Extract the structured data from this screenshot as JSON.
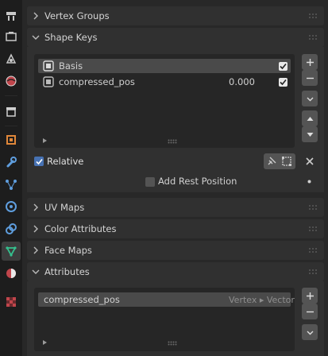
{
  "tabs": [
    {
      "icon": "tool-icon",
      "active": false
    },
    {
      "icon": "render-icon",
      "active": false
    },
    {
      "icon": "output-icon",
      "active": false
    },
    {
      "icon": "view-layer-icon",
      "active": false
    },
    {
      "icon": "scene-icon",
      "active": false
    },
    {
      "icon": "world-icon",
      "active": false
    },
    {
      "icon": "collection-icon",
      "active": false
    },
    {
      "icon": "object-icon",
      "active": false
    },
    {
      "icon": "modifier-wrench-icon",
      "active": false
    },
    {
      "icon": "particles-icon",
      "active": false
    },
    {
      "icon": "physics-icon",
      "active": false
    },
    {
      "icon": "constraints-icon",
      "active": false
    },
    {
      "icon": "mesh-data-icon",
      "active": true
    },
    {
      "icon": "material-icon",
      "active": false
    },
    {
      "icon": "texture-icon",
      "active": false
    }
  ],
  "panels": {
    "vertex_groups": {
      "title": "Vertex Groups"
    },
    "shape_keys": {
      "title": "Shape Keys",
      "items": [
        {
          "name": "Basis",
          "value": "",
          "checked": true,
          "selected": true
        },
        {
          "name": "compressed_pos",
          "value": "0.000",
          "checked": true,
          "selected": false
        }
      ],
      "relative_label": "Relative",
      "relative_checked": true,
      "add_rest_label": "Add Rest Position",
      "add_rest_checked": false
    },
    "uv_maps": {
      "title": "UV Maps"
    },
    "color_attributes": {
      "title": "Color Attributes"
    },
    "face_maps": {
      "title": "Face Maps"
    },
    "attributes": {
      "title": "Attributes",
      "items": [
        {
          "name": "compressed_pos",
          "domain_type": "Vertex ▸ Vector"
        }
      ]
    }
  },
  "colors": {
    "accent": "#4772b3",
    "selected_row": "#4a4a4a",
    "panel": "#303030"
  }
}
